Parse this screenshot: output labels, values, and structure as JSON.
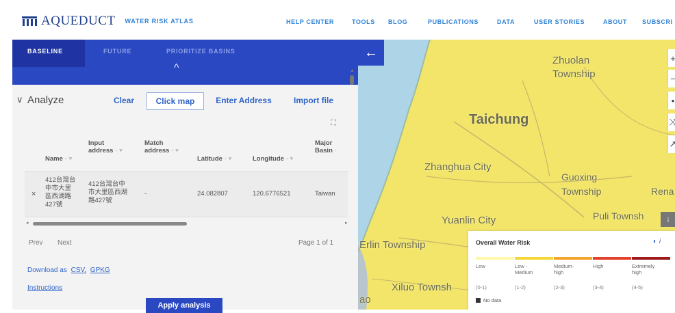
{
  "header": {
    "logo_text": "AQUEDUCT",
    "logo_subtitle": "WATER RISK ATLAS",
    "nav": [
      "HELP CENTER",
      "TOOLS",
      "BLOG",
      "PUBLICATIONS",
      "DATA",
      "USER STORIES",
      "ABOUT",
      "SUBSCRI"
    ]
  },
  "tabs": [
    "BASELINE",
    "FUTURE",
    "PRIORITIZE BASINS"
  ],
  "analyze": {
    "label": "Analyze",
    "clear": "Clear",
    "click_map": "Click map",
    "enter_address": "Enter Address",
    "import_file": "Import file"
  },
  "table": {
    "columns": [
      {
        "line1": "",
        "line2": "Name"
      },
      {
        "line1": "Input",
        "line2": "address"
      },
      {
        "line1": "Match",
        "line2": "address"
      },
      {
        "line1": "",
        "line2": "Latitude"
      },
      {
        "line1": "",
        "line2": "Longitude"
      },
      {
        "line1": "Major",
        "line2": "Basin"
      }
    ],
    "row": {
      "remove": "×",
      "name": [
        "412台灣台",
        "中市大里",
        "區西湖路",
        "427號"
      ],
      "input_address": [
        "412台灣台中",
        "市大里區西湖",
        "路427號"
      ],
      "match_address": "-",
      "latitude": "24.082807",
      "longitude": "120.6776521",
      "basin": "Taiwan"
    }
  },
  "pager": {
    "prev": "Prev",
    "next": "Next",
    "page": "Page 1 of 1"
  },
  "download": {
    "prefix": "Download as",
    "csv": "CSV,",
    "gpkg": "GPKG"
  },
  "instructions": "Instructions",
  "apply": "Apply analysis",
  "map": {
    "labels": [
      "Zhuolan",
      "Township",
      "Taichung",
      "Zhanghua City",
      "Guoxing",
      "Township",
      "Rena",
      "Puli Townsh",
      "Yuanlin City",
      "Erlin Township",
      "Xiluo Townsh",
      "ao"
    ],
    "controls": [
      "+",
      "−",
      "•",
      "⤨",
      "↗"
    ]
  },
  "legend": {
    "title": "Overall Water Risk",
    "categories": [
      {
        "label": "Low",
        "range": "(0-1)",
        "color": "#fff8a8"
      },
      {
        "label": "Low - Medium",
        "range": "(1-2)",
        "color": "#f5d838"
      },
      {
        "label": "Medium-high",
        "range": "(2-3)",
        "color": "#f2a52c"
      },
      {
        "label": "High",
        "range": "(3-4)",
        "color": "#e2412b"
      },
      {
        "label": "Extremely high",
        "range": "(4-5)",
        "color": "#9e1b1b"
      }
    ],
    "no_data": "No data"
  }
}
